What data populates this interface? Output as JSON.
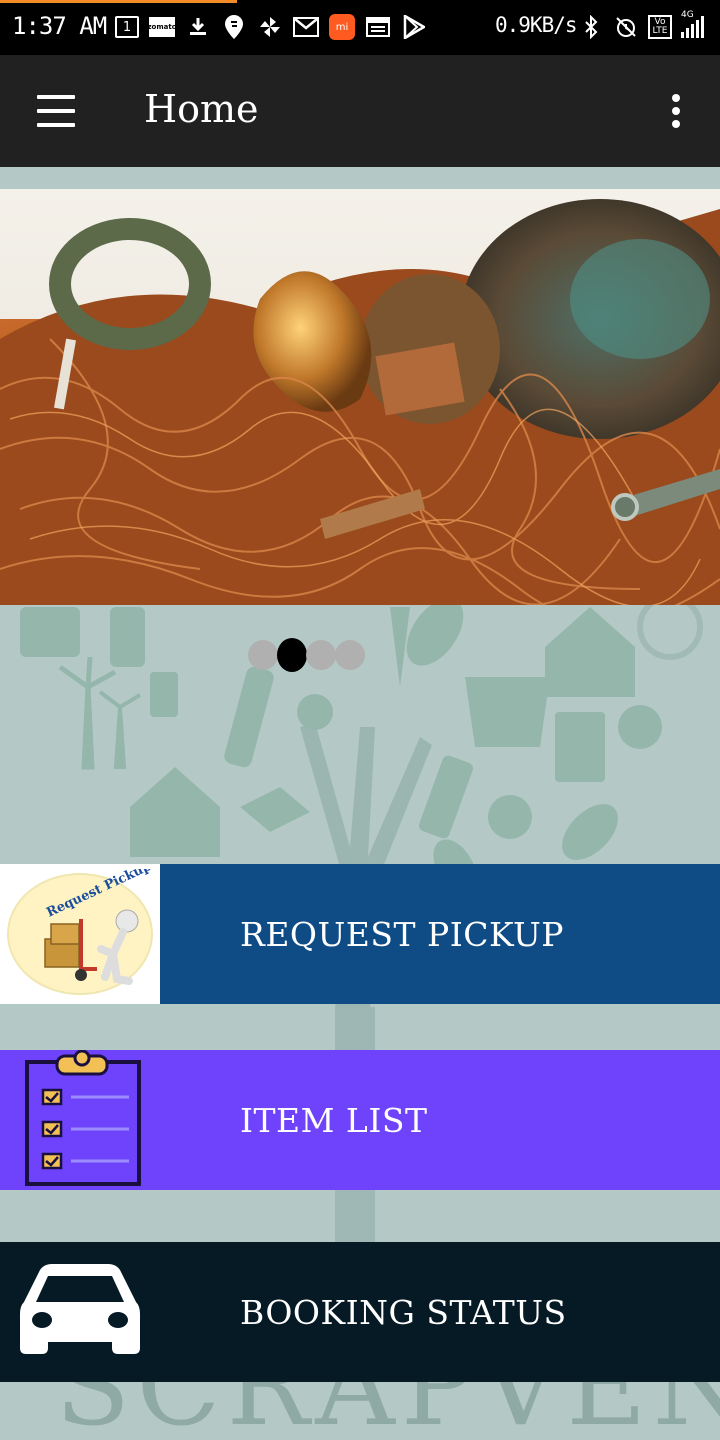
{
  "status_bar": {
    "time": "1:37 AM",
    "left_icons": [
      "calendar-1-icon",
      "zomato-icon",
      "download-icon",
      "swiggy-icon",
      "pinwheel-icon",
      "gmail-icon",
      "mi-icon",
      "news-icon",
      "play-store-icon"
    ],
    "calendar_day": "1",
    "zomato_label": "zomato",
    "mi_label": "mi",
    "net_speed": "0.9KB/s",
    "volte_label_top": "Vo",
    "volte_label_bottom": "LTE",
    "network_type": "4G"
  },
  "app_bar": {
    "title": "Home"
  },
  "carousel": {
    "slide_count": 4,
    "active_index": 1
  },
  "actions": [
    {
      "label": "REQUEST PICKUP",
      "icon_text": "Request Pickup",
      "color": "#0f4c85"
    },
    {
      "label": "ITEM LIST",
      "color": "#6f42fb"
    },
    {
      "label": "BOOKING STATUS",
      "color": "#061a26"
    }
  ],
  "background": {
    "watermark": "SCRAPVEND",
    "color": "#b4c9c6"
  }
}
